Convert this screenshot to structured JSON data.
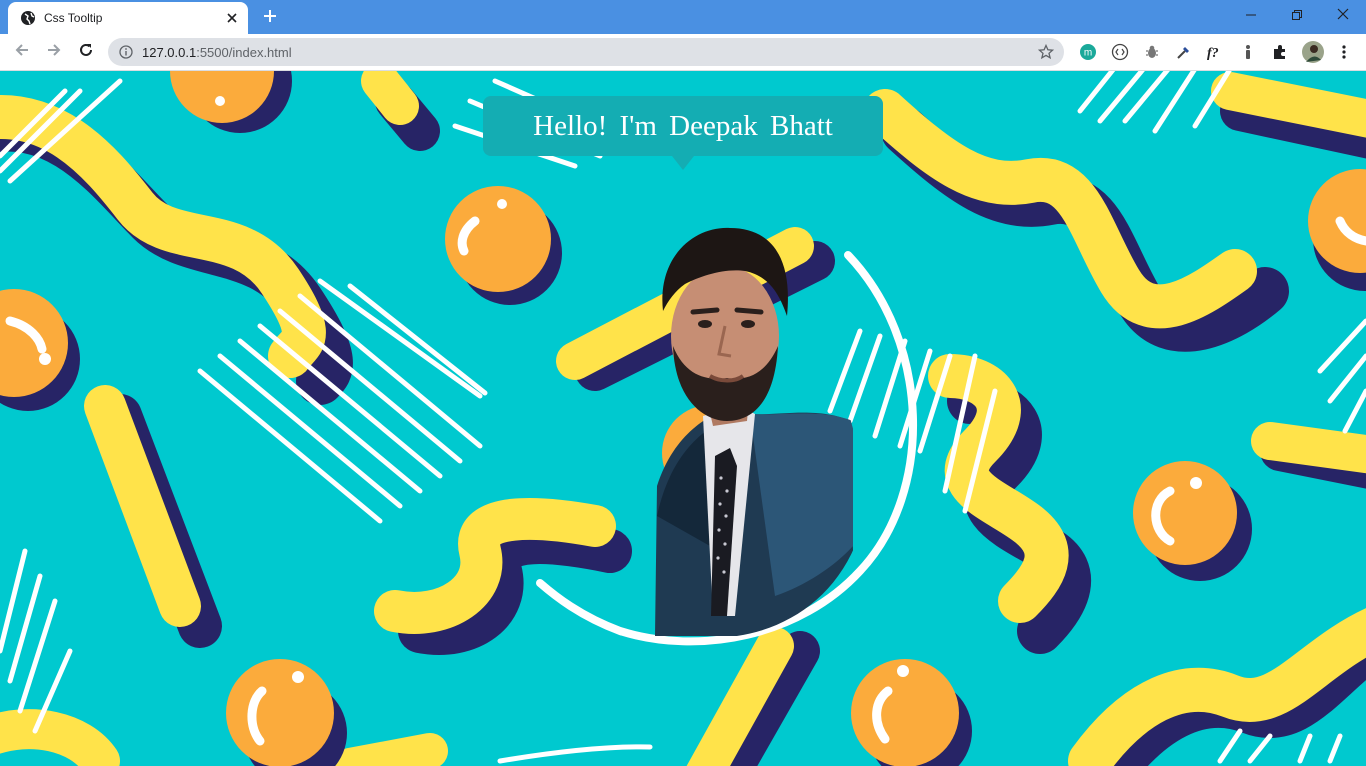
{
  "window": {
    "tab_title": "Css Tooltip",
    "tab_favicon": "globe-icon",
    "new_tab_icon": "plus-icon",
    "controls": [
      "minimize-icon",
      "restore-icon",
      "close-icon"
    ]
  },
  "toolbar": {
    "url_host": "127.0.0.1",
    "url_path": ":5500/index.html",
    "extensions": [
      "meet-extension-icon",
      "code-extension-icon",
      "bug-extension-icon",
      "eyedropper-extension-icon",
      "fonts-extension-icon",
      "info-extension-icon",
      "puzzle-extensions-icon",
      "profile-avatar",
      "more-menu-icon"
    ]
  },
  "page": {
    "tooltip_text": "Hello! I'm Deepak Bhatt",
    "colors": {
      "background": "#00c9cf",
      "yellow": "#ffe34a",
      "navy": "#272466",
      "orange": "#fbab3c",
      "tooltip": "#14adb3"
    }
  }
}
